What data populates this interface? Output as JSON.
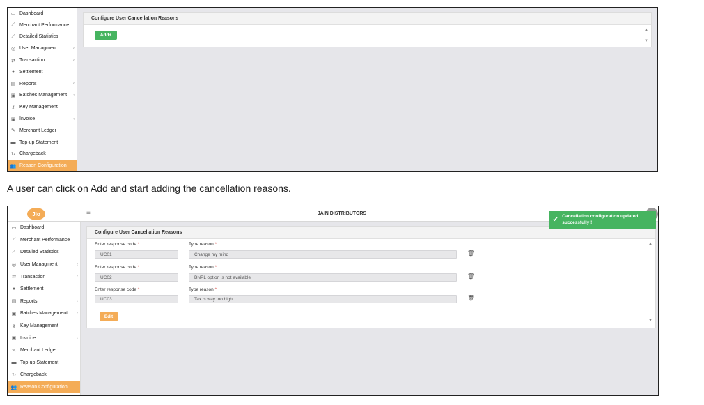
{
  "screen1": {
    "sidebar": [
      {
        "label": "Dashboard",
        "icon": "monitor-icon",
        "glyph": "▭",
        "chevron": ""
      },
      {
        "label": "Merchant Performance",
        "icon": "line-chart-icon",
        "glyph": "⟋",
        "chevron": ""
      },
      {
        "label": "Detailed Statistics",
        "icon": "line-chart-icon",
        "glyph": "⟋",
        "chevron": ""
      },
      {
        "label": "User Managment",
        "icon": "user-circle-icon",
        "glyph": "◎",
        "chevron": "‹"
      },
      {
        "label": "Transaction",
        "icon": "exchange-icon",
        "glyph": "⇄",
        "chevron": "‹"
      },
      {
        "label": "Settlement",
        "icon": "settlement-icon",
        "glyph": "●",
        "chevron": ""
      },
      {
        "label": "Reports",
        "icon": "report-icon",
        "glyph": "▤",
        "chevron": "‹"
      },
      {
        "label": "Batches Management",
        "icon": "batch-icon",
        "glyph": "▣",
        "chevron": "‹"
      },
      {
        "label": "Key Management",
        "icon": "key-icon",
        "glyph": "⚷",
        "chevron": ""
      },
      {
        "label": "Invoice",
        "icon": "invoice-icon",
        "glyph": "▣",
        "chevron": "‹"
      },
      {
        "label": "Merchant Ledger",
        "icon": "ledger-icon",
        "glyph": "✎",
        "chevron": ""
      },
      {
        "label": "Top-up Statement",
        "icon": "statement-icon",
        "glyph": "▬",
        "chevron": ""
      },
      {
        "label": "Chargeback",
        "icon": "refresh-icon",
        "glyph": "↻",
        "chevron": ""
      },
      {
        "label": "Reason Configuration",
        "icon": "users-icon",
        "glyph": "👥",
        "chevron": ""
      }
    ],
    "panel_title": "Configure User Cancellation Reasons",
    "add_label": "Add+"
  },
  "caption": "A user can click on Add and start adding the cancellation reasons.",
  "screen2": {
    "logo": "Jio",
    "brand": "JAIN DISTRIBUTORS",
    "toast": "Cancellation configuration updated successfully !",
    "sidebar": [
      {
        "label": "Dashboard",
        "icon": "monitor-icon",
        "glyph": "▭",
        "chevron": ""
      },
      {
        "label": "Merchant Performance",
        "icon": "line-chart-icon",
        "glyph": "⟋",
        "chevron": ""
      },
      {
        "label": "Detailed Statistics",
        "icon": "line-chart-icon",
        "glyph": "⟋",
        "chevron": ""
      },
      {
        "label": "User Managment",
        "icon": "user-circle-icon",
        "glyph": "◎",
        "chevron": "‹"
      },
      {
        "label": "Transaction",
        "icon": "exchange-icon",
        "glyph": "⇄",
        "chevron": "‹"
      },
      {
        "label": "Settlement",
        "icon": "settlement-icon",
        "glyph": "●",
        "chevron": ""
      },
      {
        "label": "Reports",
        "icon": "report-icon",
        "glyph": "▤",
        "chevron": "‹"
      },
      {
        "label": "Batches Management",
        "icon": "batch-icon",
        "glyph": "▣",
        "chevron": "‹"
      },
      {
        "label": "Key Management",
        "icon": "key-icon",
        "glyph": "⚷",
        "chevron": ""
      },
      {
        "label": "Invoice",
        "icon": "invoice-icon",
        "glyph": "▣",
        "chevron": "‹"
      },
      {
        "label": "Merchant Ledger",
        "icon": "ledger-icon",
        "glyph": "✎",
        "chevron": ""
      },
      {
        "label": "Top-up Statement",
        "icon": "statement-icon",
        "glyph": "▬",
        "chevron": ""
      },
      {
        "label": "Chargeback",
        "icon": "refresh-icon",
        "glyph": "↻",
        "chevron": ""
      },
      {
        "label": "Reason Configuration",
        "icon": "users-icon",
        "glyph": "👥",
        "chevron": ""
      }
    ],
    "panel_title": "Configure User Cancellation Reasons",
    "code_label": "Enter response code",
    "reason_label": "Type reason",
    "required_mark": "*",
    "rows": [
      {
        "code": "UC01",
        "reason": "Change my mind"
      },
      {
        "code": "UC02",
        "reason": "BNPL option is not available"
      },
      {
        "code": "UC03",
        "reason": "Tax is way too high"
      }
    ],
    "edit_label": "Edit"
  },
  "colors": {
    "accent": "#f4ac57",
    "success": "#46b460",
    "canvas": "#e6e6ea"
  }
}
